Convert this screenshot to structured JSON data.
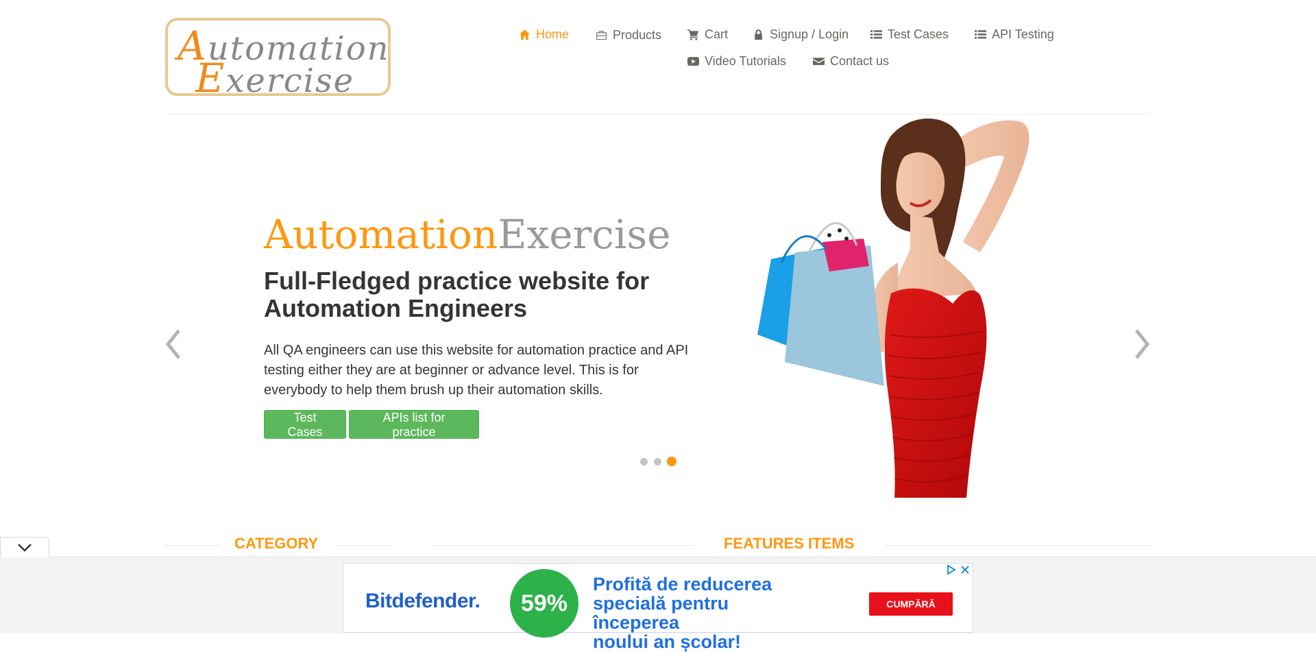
{
  "logo": {
    "line1_cap": "A",
    "line1_rest": "utomation",
    "line2_cap": "E",
    "line2_rest": "xercise"
  },
  "nav": {
    "home": {
      "label": "Home",
      "icon": "home-icon"
    },
    "products": {
      "label": "Products",
      "icon": "briefcase-icon"
    },
    "cart": {
      "label": "Cart",
      "icon": "cart-icon"
    },
    "login": {
      "label": "Signup / Login",
      "icon": "lock-icon"
    },
    "test_cases": {
      "label": "Test Cases",
      "icon": "list-icon"
    },
    "api_testing": {
      "label": "API Testing",
      "icon": "list-icon"
    },
    "video": {
      "label": "Video Tutorials",
      "icon": "youtube-icon"
    },
    "contact": {
      "label": "Contact us",
      "icon": "envelope-icon"
    }
  },
  "slider": {
    "brand_a": "Automation",
    "brand_b": "Exercise",
    "heading": "Full-Fledged practice website for Automation Engineers",
    "text": "All QA engineers can use this website for automation practice and API testing either they are at beginner or advance level. This is for everybody to help them brush up their automation skills.",
    "btn_test_cases": "Test Cases",
    "btn_apis": "APIs list for practice",
    "active_slide": 3,
    "total_slides": 3
  },
  "sections": {
    "category": "CATEGORY",
    "features": "FEATURES ITEMS"
  },
  "ad": {
    "brand": "Bitdefender.",
    "discount": "59%",
    "line1": "Profită de reducerea",
    "line2": "specială pentru începerea",
    "line3": "noului an școlar!",
    "cta": "CUMPĂRĂ"
  },
  "colors": {
    "accent": "#fe980f",
    "button_green": "#5cb85c",
    "ad_blue": "#1f6fe0",
    "ad_red": "#e8101a"
  }
}
